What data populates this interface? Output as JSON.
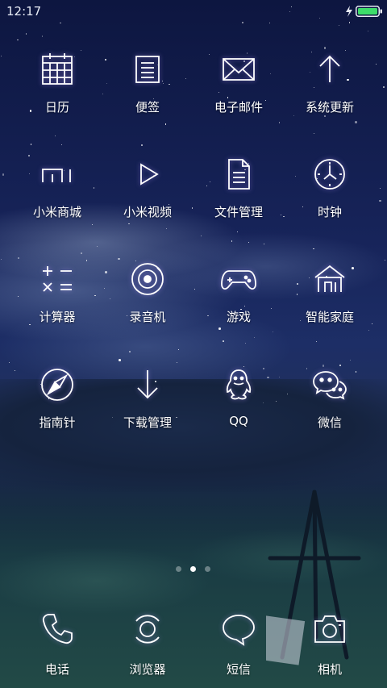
{
  "status_bar": {
    "time": "12:17",
    "battery_level": 1.0,
    "charging": true,
    "battery_color": "#3ddc6a"
  },
  "home_grid": {
    "apps": [
      {
        "label": "日历",
        "icon": "calendar-icon"
      },
      {
        "label": "便签",
        "icon": "notes-icon"
      },
      {
        "label": "电子邮件",
        "icon": "mail-icon"
      },
      {
        "label": "系统更新",
        "icon": "update-arrow-icon"
      },
      {
        "label": "小米商城",
        "icon": "mi-store-icon"
      },
      {
        "label": "小米视频",
        "icon": "video-play-icon"
      },
      {
        "label": "文件管理",
        "icon": "file-icon"
      },
      {
        "label": "时钟",
        "icon": "clock-icon"
      },
      {
        "label": "计算器",
        "icon": "calculator-icon"
      },
      {
        "label": "录音机",
        "icon": "recorder-icon"
      },
      {
        "label": "游戏",
        "icon": "gamepad-icon"
      },
      {
        "label": "智能家庭",
        "icon": "smart-home-icon"
      },
      {
        "label": "指南针",
        "icon": "compass-icon"
      },
      {
        "label": "下载管理",
        "icon": "download-icon"
      },
      {
        "label": "QQ",
        "icon": "qq-penguin-icon"
      },
      {
        "label": "微信",
        "icon": "wechat-icon"
      }
    ]
  },
  "page_indicator": {
    "pages": 3,
    "current": 2
  },
  "dock": {
    "apps": [
      {
        "label": "电话",
        "icon": "phone-icon"
      },
      {
        "label": "浏览器",
        "icon": "browser-icon"
      },
      {
        "label": "短信",
        "icon": "message-bubble-icon"
      },
      {
        "label": "相机",
        "icon": "camera-icon"
      }
    ]
  },
  "theme": {
    "icon_stroke": "#ffffff",
    "icon_glow": "#b39bff"
  }
}
